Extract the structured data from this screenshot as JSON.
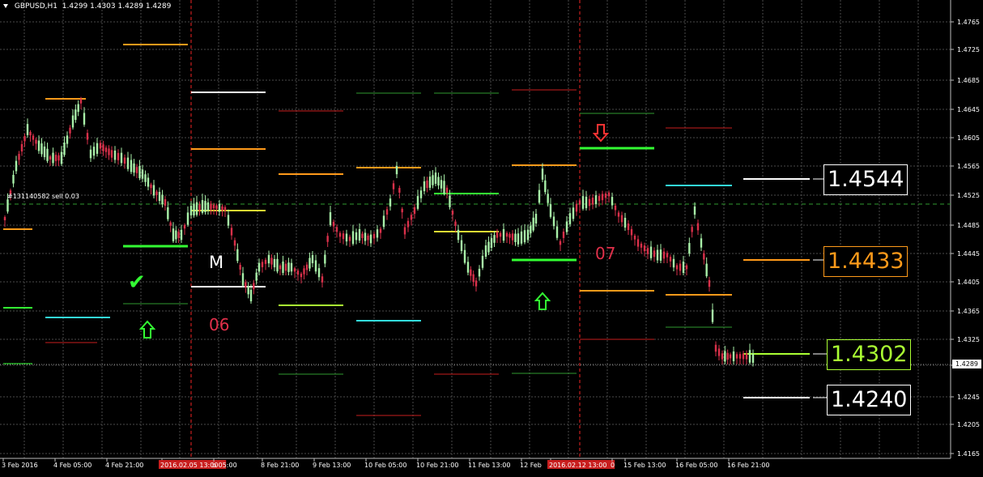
{
  "header": {
    "symbol": "GBPUSD,H1",
    "ohlc": "1.4299 1.4303 1.4289 1.4289"
  },
  "order_label": "#131140582 sell 0.03",
  "annotations": {
    "m_label": "M",
    "session_06": "06",
    "session_07": "07"
  },
  "level_boxes": [
    {
      "text": "1.4544",
      "color": "#ffffff"
    },
    {
      "text": "1.4433",
      "color": "#ff9a1a"
    },
    {
      "text": "1.4302",
      "color": "#aaff33"
    },
    {
      "text": "1.4240",
      "color": "#ffffff"
    }
  ],
  "price_axis": {
    "ticks": [
      "1.4765",
      "1.4725",
      "1.4685",
      "1.4645",
      "1.4605",
      "1.4565",
      "1.4525",
      "1.4485",
      "1.4445",
      "1.4405",
      "1.4365",
      "1.4325",
      "1.4285",
      "1.4245",
      "1.4205",
      "1.4165"
    ],
    "current_price": "1.4289"
  },
  "time_axis": {
    "labels": [
      "3 Feb 2016",
      "4 Feb 05:00",
      "4 Feb 21:00",
      "2016.02.05 13:00",
      "b 05:00",
      "8 Feb 21:00",
      "9 Feb 13:00",
      "10 Feb 05:00",
      "10 Feb 21:00",
      "11 Feb 13:00",
      "12 Feb",
      "2016.02.12 13:00",
      "0",
      "15 Feb 13:00",
      "16 Feb 05:00",
      "16 Feb 21:00"
    ]
  },
  "colors": {
    "grid": "#4a4a4a",
    "bull_candle": "#a8f0a8",
    "bear_candle": "#d9304a",
    "session_line": "#c81e1e",
    "accent_orange": "#ff9a1a",
    "accent_green": "#33ff33",
    "accent_lime": "#aaff33",
    "accent_cyan": "#33dddd",
    "accent_red": "#ff3333"
  },
  "icons": [
    "dropdown-triangle-icon",
    "check-icon",
    "up-arrow-icon",
    "down-arrow-icon"
  ]
}
